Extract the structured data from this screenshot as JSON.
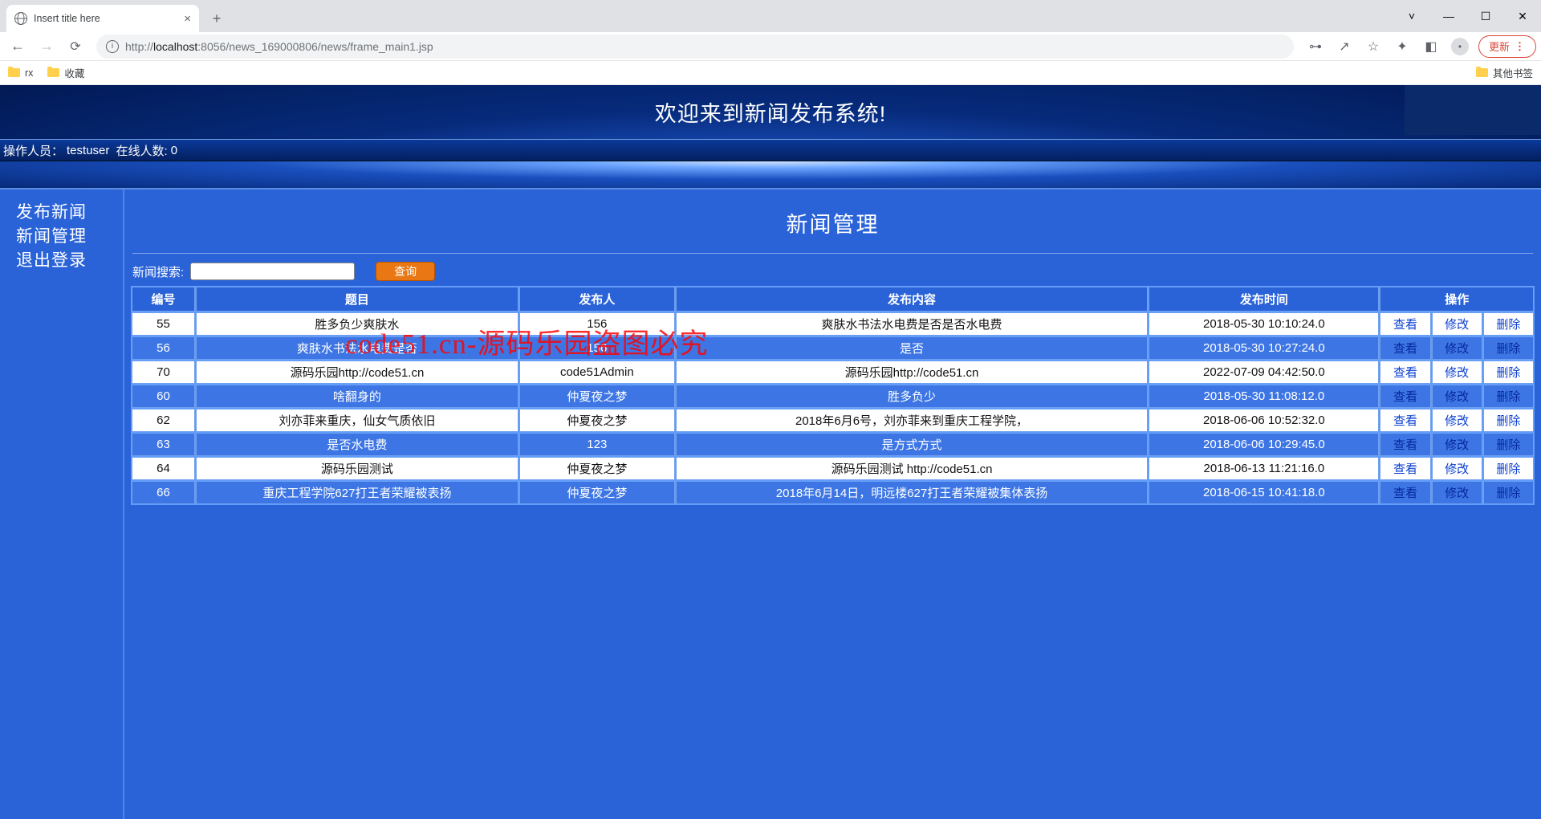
{
  "browser": {
    "tab_title": "Insert title here",
    "url_dim_prefix": "http://",
    "url_host": "localhost",
    "url_dim_suffix": ":8056/news_169000806/news/frame_main1.jsp",
    "update_label": "更新",
    "bookmarks": {
      "rx": "rx",
      "fav": "收藏",
      "other": "其他书签"
    }
  },
  "banner": {
    "title": "欢迎来到新闻发布系统!"
  },
  "status": {
    "operator_label": "操作人员：",
    "operator_value": "testuser",
    "online_label": "在线人数:",
    "online_value": "0"
  },
  "sidebar": {
    "items": [
      {
        "label": "发布新闻"
      },
      {
        "label": "新闻管理"
      },
      {
        "label": "退出登录"
      }
    ]
  },
  "main": {
    "heading": "新闻管理",
    "search_label": "新闻搜索:",
    "search_btn": "查询",
    "columns": {
      "id": "编号",
      "title": "题目",
      "author": "发布人",
      "content": "发布内容",
      "time": "发布时间",
      "actions": "操作"
    },
    "act": {
      "view": "查看",
      "edit": "修改",
      "del": "删除"
    },
    "rows": [
      {
        "id": "55",
        "title": "胜多负少爽肤水",
        "author": "156",
        "content": "爽肤水书法水电费是否是否水电费",
        "time": "2018-05-30 10:10:24.0"
      },
      {
        "id": "56",
        "title": "爽肤水书法水电费是否",
        "author": "156",
        "content": "是否",
        "time": "2018-05-30 10:27:24.0"
      },
      {
        "id": "70",
        "title": "源码乐园http://code51.cn",
        "author": "code51Admin",
        "content": "源码乐园http://code51.cn",
        "time": "2022-07-09 04:42:50.0"
      },
      {
        "id": "60",
        "title": "啥翻身的",
        "author": "仲夏夜之梦",
        "content": "胜多负少",
        "time": "2018-05-30 11:08:12.0"
      },
      {
        "id": "62",
        "title": "刘亦菲来重庆，仙女气质依旧",
        "author": "仲夏夜之梦",
        "content": "2018年6月6号，刘亦菲来到重庆工程学院，",
        "time": "2018-06-06 10:52:32.0"
      },
      {
        "id": "63",
        "title": "是否水电费",
        "author": "123",
        "content": "是方式方式",
        "time": "2018-06-06 10:29:45.0"
      },
      {
        "id": "64",
        "title": "源码乐园测试",
        "author": "仲夏夜之梦",
        "content": "源码乐园测试 http://code51.cn",
        "time": "2018-06-13 11:21:16.0"
      },
      {
        "id": "66",
        "title": "重庆工程学院627打王者荣耀被表扬",
        "author": "仲夏夜之梦",
        "content": "2018年6月14日，明远楼627打王者荣耀被集体表扬",
        "time": "2018-06-15 10:41:18.0"
      }
    ]
  },
  "watermark": "code51.cn-源码乐园盗图必究"
}
